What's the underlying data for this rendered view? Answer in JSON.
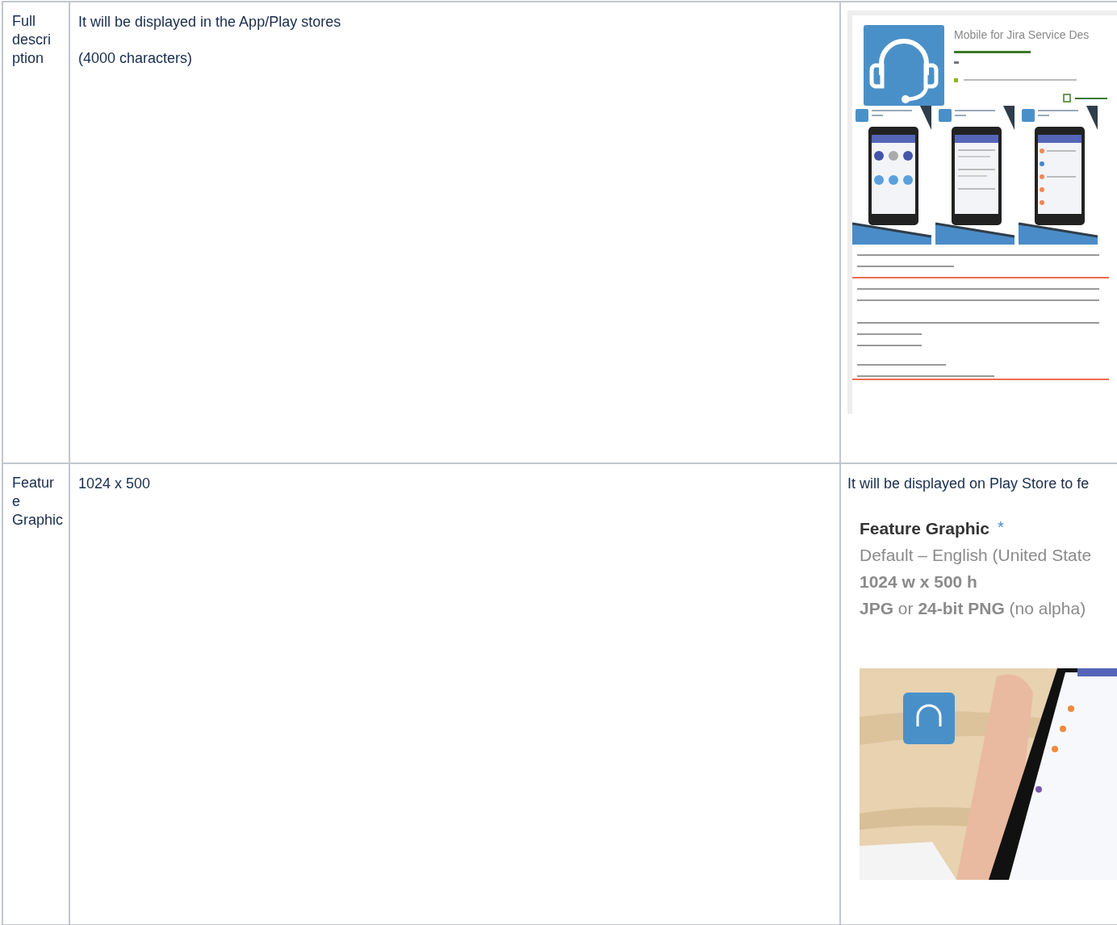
{
  "table": {
    "rows": [
      {
        "label_lines": [
          "Full",
          "descri",
          "ption"
        ],
        "text_lines": [
          "It will be displayed in the App/Play stores",
          "(4000 characters)"
        ],
        "example": {
          "kind": "store_listing",
          "app_title": "Mobile for Jira Service Des"
        }
      },
      {
        "label_lines": [
          "Featur",
          "e",
          "Graphic"
        ],
        "text_lines": [
          "1024 x 500"
        ],
        "example": {
          "kind": "graphic_spec",
          "caption": "It will be displayed on Play Store to fe",
          "spec_title": "Feature Graphic",
          "required_mark": "*",
          "spec_lines": [
            "Default – English (United State",
            "**1024 w x 500 h**",
            "**JPG** or **24-bit PNG** (no alpha)"
          ]
        }
      }
    ]
  }
}
